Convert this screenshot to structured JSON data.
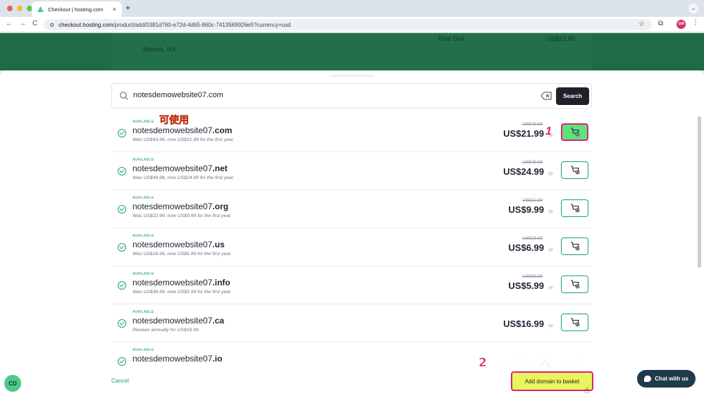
{
  "browser": {
    "tab_title": "Checkout | hosting.com",
    "tab_close": "×",
    "new_tab": "+",
    "tab_menu": "⌄",
    "url_host": "checkout.hosting.com",
    "url_path": "/product/add/0381d760-e72d-4d65-860c-7413569926e5?currency=usd",
    "profile_initials": "GW",
    "back": "←",
    "forward": "→",
    "reload": "C",
    "star": "☆",
    "menu": "⋮"
  },
  "background_page": {
    "location": "Mexico, MX",
    "total_due_label": "Total Due",
    "total_due_value": "US$23.89"
  },
  "search": {
    "value": "notesdemowebsite07.com",
    "button_label": "Search"
  },
  "results": [
    {
      "status": "AVAILABLE",
      "name": "notesdemowebsite07",
      "tld": ".com",
      "note": "Was US$43.98, now US$21.99 for the first year.",
      "old_price": "US$43.98",
      "price": "US$21.99",
      "per": "/yr"
    },
    {
      "status": "AVAILABLE",
      "name": "notesdemowebsite07",
      "tld": ".net",
      "note": "Was US$49.98, now US$24.99 for the first year.",
      "old_price": "US$49.98",
      "price": "US$24.99",
      "per": "/yr"
    },
    {
      "status": "AVAILABLE",
      "name": "notesdemowebsite07",
      "tld": ".org",
      "note": "Was US$22.99, now US$9.99 for the first year.",
      "old_price": "US$22.99",
      "price": "US$9.99",
      "per": "/yr"
    },
    {
      "status": "AVAILABLE",
      "name": "notesdemowebsite07",
      "tld": ".us",
      "note": "Was US$18.99, now US$6.99 for the first year.",
      "old_price": "US$18.99",
      "price": "US$6.99",
      "per": "/yr"
    },
    {
      "status": "AVAILABLE",
      "name": "notesdemowebsite07",
      "tld": ".info",
      "note": "Was US$36.99, now US$5.99 for the first year.",
      "old_price": "US$36.99",
      "price": "US$5.99",
      "per": "/yr"
    },
    {
      "status": "AVAILABLE",
      "name": "notesdemowebsite07",
      "tld": ".ca",
      "note": "Renews annually for US$16.99.",
      "old_price": "",
      "price": "US$16.99",
      "per": "/yr"
    },
    {
      "status": "AVAILABLE",
      "name": "notesdemowebsite07",
      "tld": ".io",
      "note": "",
      "old_price": "",
      "price": "",
      "per": ""
    }
  ],
  "annotations": {
    "available_tag": "可使用",
    "step1": "1",
    "step2": "2 將域名加入購物車"
  },
  "footer": {
    "cancel_label": "Cancel",
    "add_button_label": "Add domain to basket"
  },
  "chat": {
    "label": "Chat with us"
  },
  "badge": {
    "label": "CD"
  },
  "colors": {
    "accent_green": "#16a37a",
    "highlight_pink": "#e0217a",
    "highlight_yellow": "#e8f55e",
    "highlight_green": "#5ee37b"
  }
}
